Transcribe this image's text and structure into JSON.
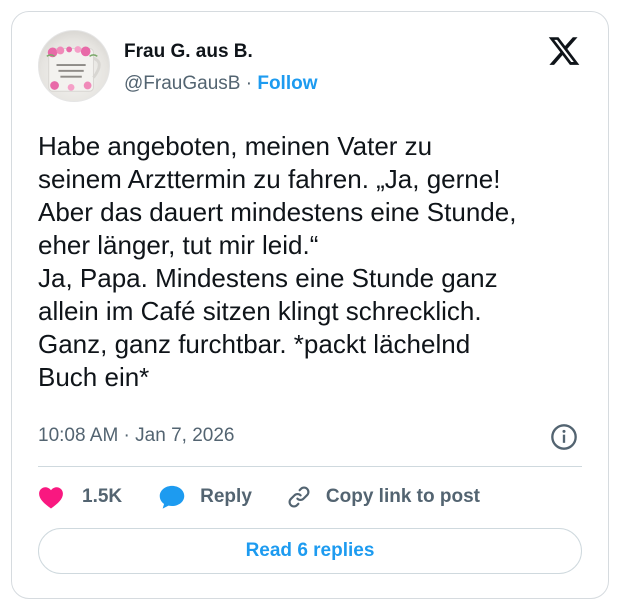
{
  "author": {
    "name": "Frau G. aus B.",
    "handle": "@FrauGausB",
    "separator": "·",
    "follow_label": "Follow"
  },
  "tweet": {
    "text": "Habe angeboten, meinen Vater zu\nseinem Arzttermin zu fahren. „Ja, gerne!\nAber das dauert mindestens eine Stunde,\neher länger, tut mir leid.“\nJa, Papa. Mindestens eine Stunde ganz\nallein im Café sitzen klingt schrecklich.\nGanz, ganz furchtbar. *packt lächelnd\nBuch ein*",
    "timestamp": "10:08 AM · Jan 7, 2026"
  },
  "actions": {
    "like_count": "1.5K",
    "reply_label": "Reply",
    "copy_link_label": "Copy link to post"
  },
  "read_replies_label": "Read 6 replies",
  "icons": {
    "like": "heart-icon",
    "reply": "speech-bubble-icon",
    "copy": "link-icon",
    "info": "info-icon",
    "brand": "x-logo-icon"
  },
  "colors": {
    "accent": "#1d9bf0",
    "like": "#f91880",
    "text": "#0f1419",
    "muted": "#536471"
  }
}
